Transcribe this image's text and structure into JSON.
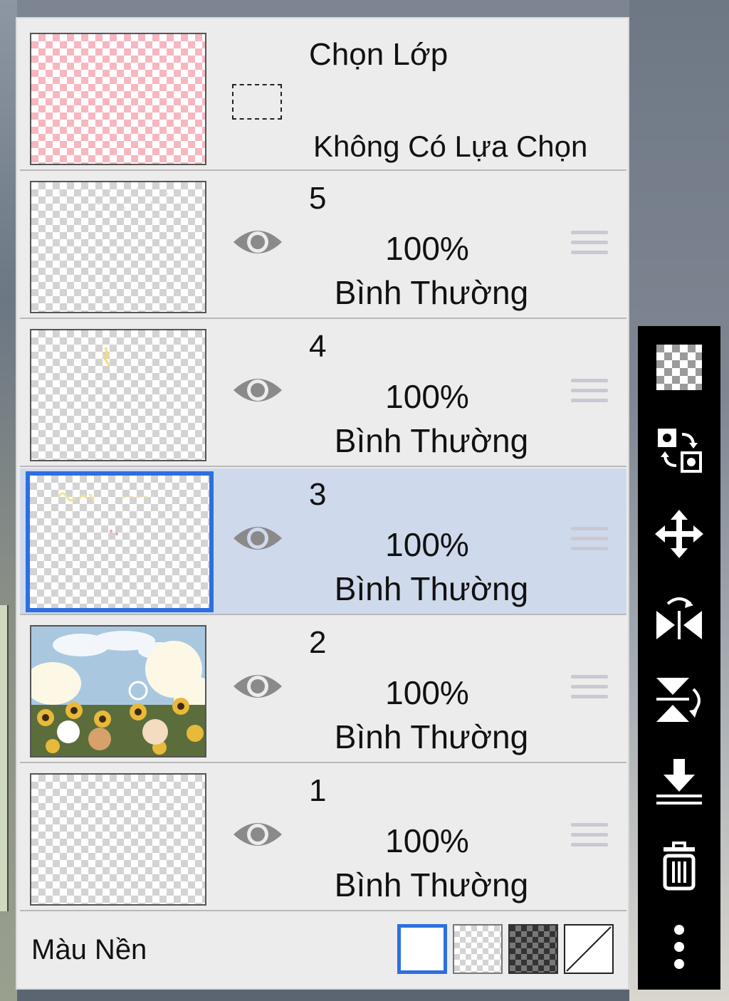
{
  "selection_layer": {
    "title": "Chọn Lớp",
    "subtitle": "Không Có Lựa Chọn"
  },
  "layers": [
    {
      "name": "5",
      "opacity": "100%",
      "blend_mode": "Bình Thường",
      "visible": true,
      "selected": false
    },
    {
      "name": "4",
      "opacity": "100%",
      "blend_mode": "Bình Thường",
      "visible": true,
      "selected": false
    },
    {
      "name": "3",
      "opacity": "100%",
      "blend_mode": "Bình Thường",
      "visible": true,
      "selected": true
    },
    {
      "name": "2",
      "opacity": "100%",
      "blend_mode": "Bình Thường",
      "visible": true,
      "selected": false
    },
    {
      "name": "1",
      "opacity": "100%",
      "blend_mode": "Bình Thường",
      "visible": true,
      "selected": false
    }
  ],
  "background_color": {
    "label": "Màu Nền",
    "options": [
      "white",
      "transparent",
      "dark-checker",
      "none"
    ],
    "selected": "white"
  },
  "toolbar": {
    "tools": [
      "transparency-icon",
      "swap-layers-icon",
      "move-icon",
      "flip-horizontal-icon",
      "flip-vertical-icon",
      "merge-down-icon",
      "trash-icon",
      "more-icon"
    ]
  },
  "colors": {
    "accent": "#2e6fe0",
    "selected_row": "#cfd9ec",
    "panel": "#ececec",
    "toolbar": "#000000"
  }
}
